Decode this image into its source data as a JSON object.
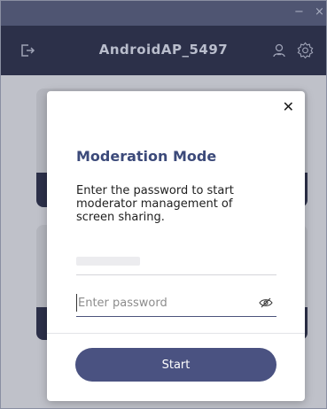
{
  "window": {
    "minimize_glyph": "−",
    "close_glyph": "×"
  },
  "appbar": {
    "title": "AndroidAP_5497",
    "icons": [
      "exit-icon",
      "user-icon",
      "gear-icon"
    ]
  },
  "dialog": {
    "close_glyph": "✕",
    "title": "Moderation Mode",
    "description": "Enter the password to start moderator management of screen sharing.",
    "password_placeholder": "Enter password",
    "password_value": "",
    "start_label": "Start",
    "icons": [
      "eye-hidden-icon"
    ]
  },
  "colors": {
    "titlebar": "#4f5572",
    "appbar": "#2c3049",
    "accent": "#4a5281",
    "title_text": "#3c4a7a"
  }
}
